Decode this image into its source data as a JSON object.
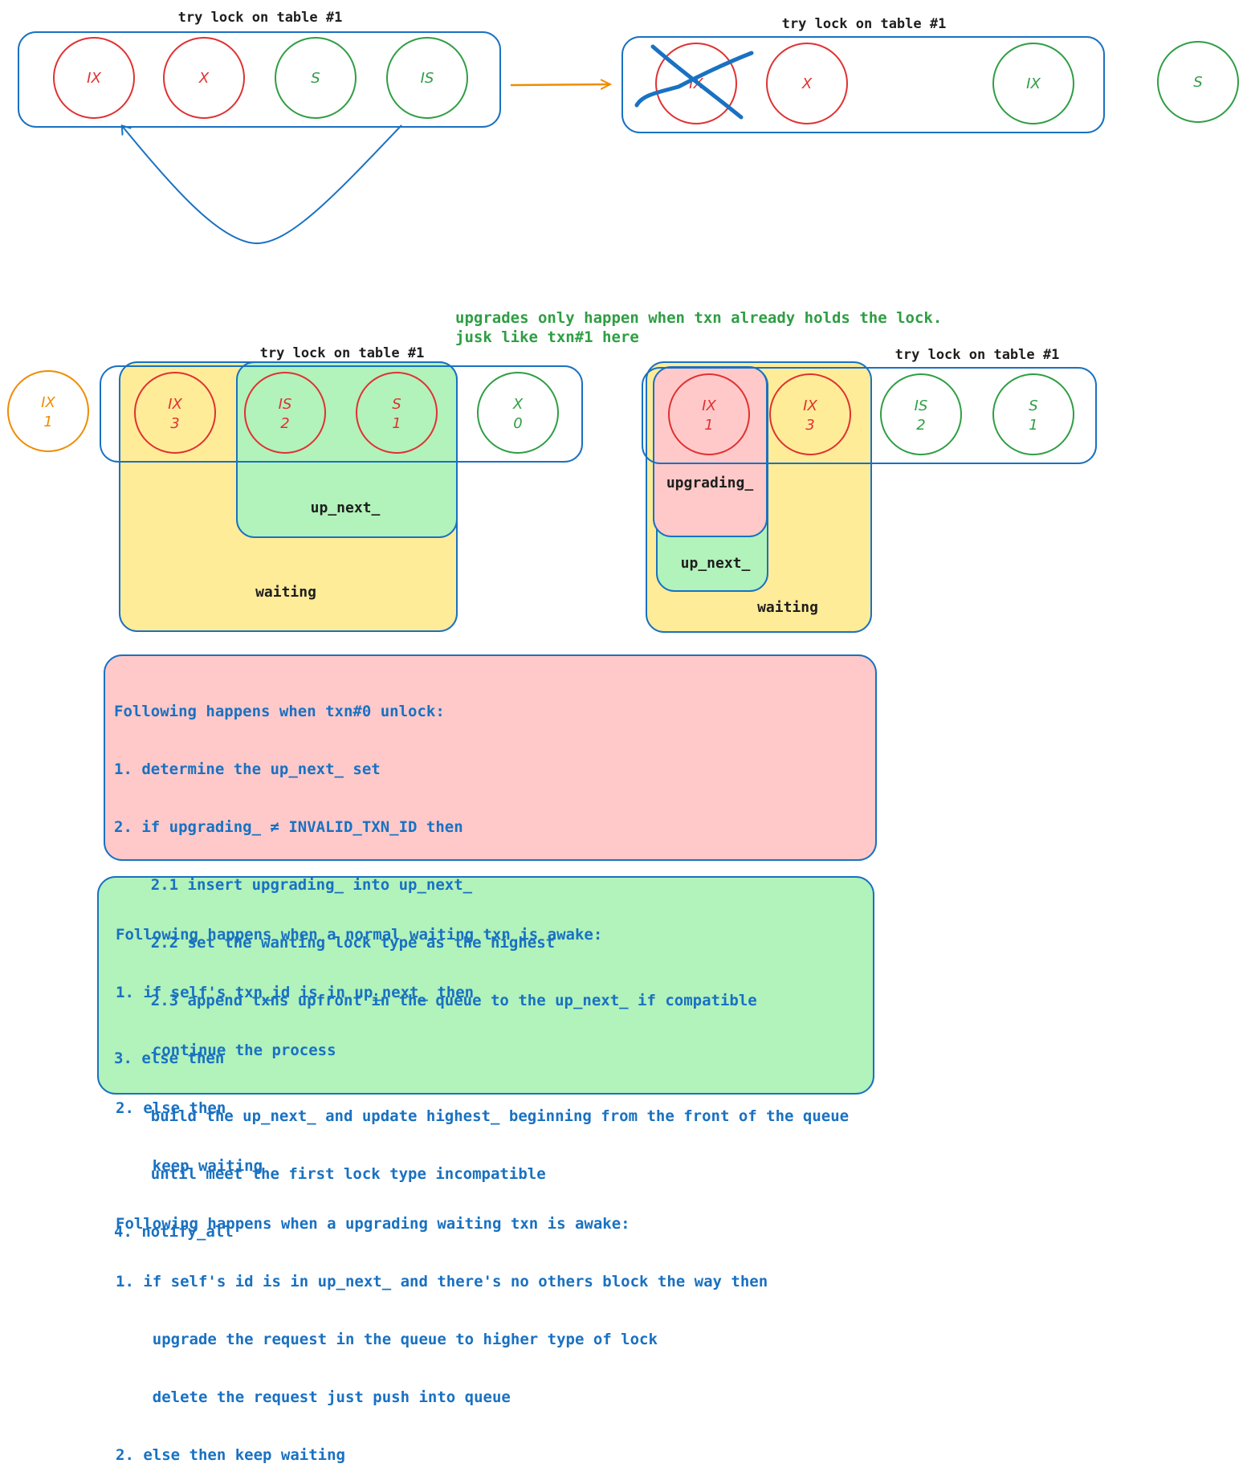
{
  "colors": {
    "red": "#e03131",
    "green": "#2f9e44",
    "blue": "#1971c2",
    "orange": "#f08c00",
    "yellow_fill": "#ffec99",
    "green_fill": "#b2f2bb",
    "pink_fill": "#ffc9c9"
  },
  "panel1": {
    "title": "try lock on table #1",
    "nodes": [
      {
        "label": "IX",
        "color": "red"
      },
      {
        "label": "X",
        "color": "red"
      },
      {
        "label": "S",
        "color": "green"
      },
      {
        "label": "IS",
        "color": "green"
      }
    ]
  },
  "panel2": {
    "title": "try lock on table #1",
    "nodes": [
      {
        "label": "IX",
        "color": "red"
      },
      {
        "label": "X",
        "color": "red"
      },
      {
        "label": "IX",
        "color": "green"
      }
    ],
    "outside_node": {
      "label": "S",
      "color": "green"
    }
  },
  "upgrade_note": {
    "line1": "upgrades only happen when txn already holds the lock.",
    "line2": "jusk like txn#1 here"
  },
  "panel3": {
    "title": "try lock on table #1",
    "outside_node": {
      "label": "IX",
      "sub": "1",
      "color": "orange"
    },
    "nodes": [
      {
        "label": "IX",
        "sub": "3",
        "color": "red"
      },
      {
        "label": "IS",
        "sub": "2",
        "color": "red"
      },
      {
        "label": "S",
        "sub": "1",
        "color": "red"
      },
      {
        "label": "X",
        "sub": "0",
        "color": "green"
      }
    ],
    "up_next_label": "up_next_",
    "waiting_label": "waiting"
  },
  "panel4": {
    "title": "try lock on table #1",
    "nodes": [
      {
        "label": "IX",
        "sub": "1",
        "color": "red"
      },
      {
        "label": "IX",
        "sub": "3",
        "color": "red"
      },
      {
        "label": "IS",
        "sub": "2",
        "color": "green"
      },
      {
        "label": "S",
        "sub": "1",
        "color": "green"
      }
    ],
    "upgrading_label": "upgrading_",
    "up_next_label": "up_next_",
    "waiting_label": "waiting"
  },
  "unlock_steps": [
    "Following happens when txn#0 unlock:",
    "1. determine the up_next_ set",
    "2. if upgrading_ ≠ INVALID_TXN_ID then",
    "    2.1 insert upgrading_ into up_next_",
    "    2.2 set the wanting lock type as the highest",
    "    2.3 append txns upfront in the queue to the up_next_ if compatible",
    "3. else then",
    "    build the up_next_ and update highest_ beginning from the front of the queue",
    "    until meet the first lock type incompatible",
    "4. notify_all"
  ],
  "awake_steps": [
    "Following happens when a normal waiting txn is awake:",
    "1. if self's txn_id is in up_next_ then",
    "    continue the process",
    "2. else then",
    "    keep waiting",
    "Following happens when a upgrading waiting txn is awake:",
    "1. if self's id is in up_next_ and there's no others block the way then",
    "    upgrade the request in the queue to higher type of lock",
    "    delete the request just push into queue",
    "2. else then keep waiting"
  ]
}
